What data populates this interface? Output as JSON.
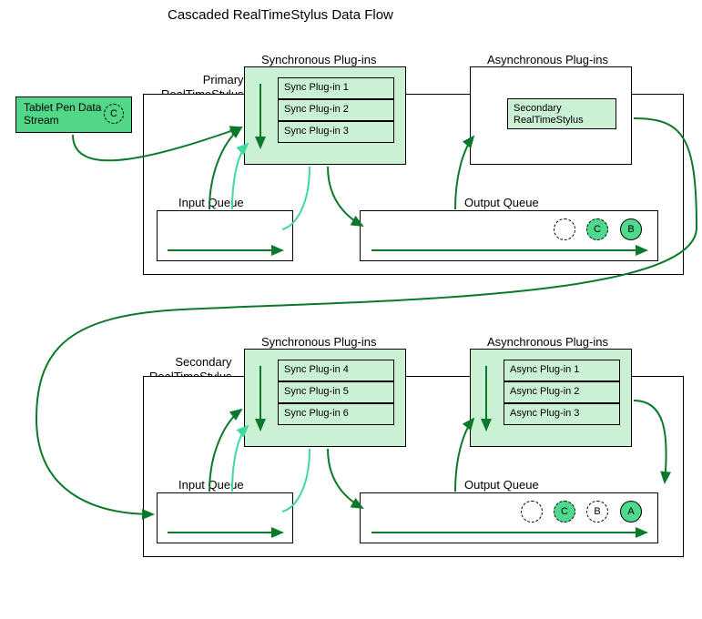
{
  "title": "Cascaded RealTimeStylus Data Flow",
  "tablet": {
    "label": "Tablet Pen\nData Stream",
    "badge": "C"
  },
  "primary": {
    "label": "Primary\nRealTimeStylus",
    "sync_header": "Synchronous Plug-ins",
    "async_header": "Asynchronous Plug-ins",
    "sync_plugins": [
      "Sync Plug-in 1",
      "Sync Plug-in 2",
      "Sync Plug-in 3"
    ],
    "async_content": "Secondary\nRealTimeStylus",
    "input_queue_label": "Input Queue",
    "output_queue_label": "Output Queue",
    "output_tokens": [
      "",
      "C",
      "B"
    ]
  },
  "secondary": {
    "label": "Secondary\nRealTimeStylus",
    "sync_header": "Synchronous Plug-ins",
    "async_header": "Asynchronous Plug-ins",
    "sync_plugins": [
      "Sync Plug-in 4",
      "Sync Plug-in 5",
      "Sync Plug-in 6"
    ],
    "async_plugins": [
      "Async Plug-in 1",
      "Async Plug-in 2",
      "Async Plug-in 3"
    ],
    "input_queue_label": "Input Queue",
    "output_queue_label": "Output Queue",
    "output_tokens": [
      "",
      "C",
      "B",
      "A"
    ]
  },
  "colors": {
    "flow_dark": "#0a7a2a",
    "flow_light": "#3fd9a1"
  }
}
